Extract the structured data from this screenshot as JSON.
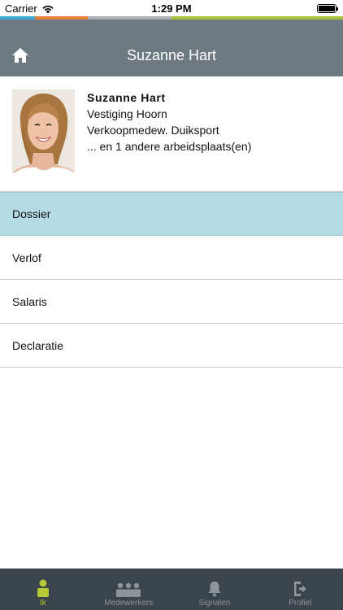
{
  "status_bar": {
    "carrier": "Carrier",
    "time": "1:29 PM"
  },
  "color_strip": [
    "#3fa9d6",
    "#e87f3a",
    "#aab0b5",
    "#a5c43c"
  ],
  "nav": {
    "title": "Suzanne Hart",
    "home_icon": "home-icon"
  },
  "profile": {
    "name": "Suzanne Hart",
    "location": "Vestiging Hoorn",
    "role": "Verkoopmedew. Duiksport",
    "more": "... en 1 andere arbeidsplaats(en)"
  },
  "menu": {
    "items": [
      {
        "label": "Dossier",
        "active": true
      },
      {
        "label": "Verlof",
        "active": false
      },
      {
        "label": "Salaris",
        "active": false
      },
      {
        "label": "Declaratie",
        "active": false
      }
    ]
  },
  "tab_bar": {
    "tabs": [
      {
        "label": "Ik",
        "icon": "person-icon",
        "active": true
      },
      {
        "label": "Medewerkers",
        "icon": "people-icon",
        "active": false
      },
      {
        "label": "Signalen",
        "icon": "bell-icon",
        "active": false
      },
      {
        "label": "Profiel",
        "icon": "logout-icon",
        "active": false
      }
    ]
  },
  "colors": {
    "nav_background": "#6d7a80",
    "active_row": "#b5dbe6",
    "tab_bar_background": "#3c444b",
    "tab_active": "#b6c936",
    "tab_inactive": "#8d959a"
  }
}
